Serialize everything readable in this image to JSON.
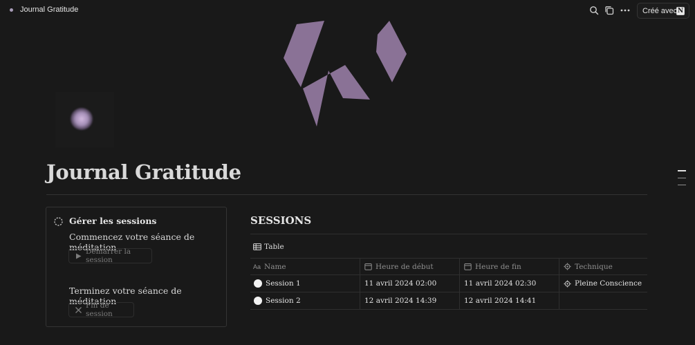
{
  "topbar": {
    "title": "Journal Gratitude",
    "made_with": "Créé avec",
    "made_with_logo": "N",
    "icons": [
      "search-icon",
      "duplicate-icon",
      "more-icon"
    ]
  },
  "page": {
    "title": "Journal Gratitude",
    "cover": "purple-logo-cover",
    "icon": "glowing-orb"
  },
  "sessions_panel": {
    "heading": "Gérer les sessions",
    "start_text": "Commencez votre séance de méditation",
    "start_button": "Démarrer la session",
    "end_text": "Terminez votre séance de méditation",
    "end_button": "Fin de session"
  },
  "database": {
    "title": "SESSIONS",
    "view_label": "Table",
    "columns": [
      {
        "label": "Name",
        "icon": "aa-text-icon"
      },
      {
        "label": "Heure de début",
        "icon": "calendar-icon"
      },
      {
        "label": "Heure de fin",
        "icon": "calendar-icon"
      },
      {
        "label": "Technique",
        "icon": "gear-icon"
      }
    ],
    "rows": [
      {
        "name": "Session 1",
        "start": "11 avril 2024 02:00",
        "end": "11 avril 2024 02:30",
        "technique": "Pleine Conscience"
      },
      {
        "name": "Session 2",
        "start": "12 avril 2024 14:39",
        "end": "12 avril 2024 14:41",
        "technique": ""
      }
    ]
  },
  "colors": {
    "background": "#191919",
    "cover_purple": "#8a7296",
    "border": "#2f2f2f"
  }
}
